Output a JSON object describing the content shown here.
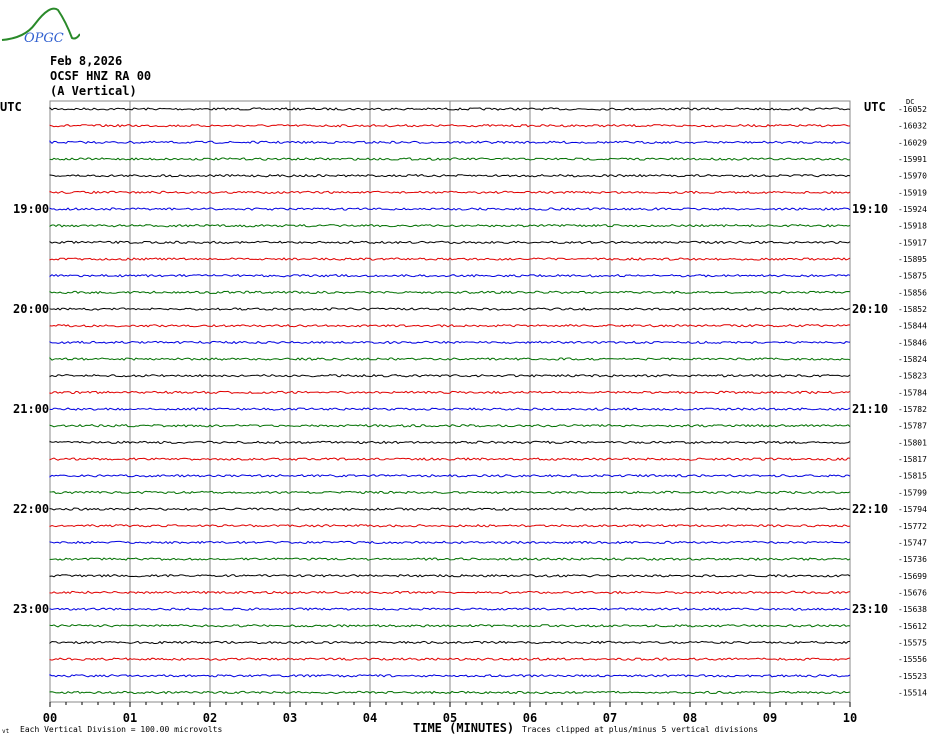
{
  "logo_text": "OPGC",
  "header": {
    "date": "Feb 8,2026",
    "station": "OCSF HNZ RA 00",
    "component": "(A Vertical)"
  },
  "left_utc": "UTC",
  "right_utc": "UTC",
  "dc_label": "DC",
  "left_times": [
    "19:00",
    "20:00",
    "21:00",
    "22:00",
    "23:00"
  ],
  "right_times": [
    "19:10",
    "20:10",
    "21:10",
    "22:10",
    "23:10"
  ],
  "footer": {
    "scale": "Each Vertical Division =  100.00 microvolts",
    "xlabel": "TIME (MINUTES)",
    "clip_note": "Traces clipped at plus/minus 5 vertical divisions",
    "corner": "vt"
  },
  "chart_data": {
    "type": "line",
    "title": "OCSF HNZ RA 00 helicorder",
    "xlabel": "TIME (MINUTES)",
    "xlim": [
      0,
      10
    ],
    "xticks": [
      "00",
      "01",
      "02",
      "03",
      "04",
      "05",
      "06",
      "07",
      "08",
      "09",
      "10"
    ],
    "trace_colors": [
      "#000000",
      "#e00000",
      "#0000e0",
      "#007000"
    ],
    "trace_count": 36,
    "dc_offsets": [
      -16052,
      -16032,
      -16029,
      -15991,
      -15970,
      -15919,
      -15924,
      -15918,
      -15917,
      -15895,
      -15875,
      -15856,
      -15852,
      -15844,
      -15846,
      -15824,
      -15823,
      -15784,
      -15782,
      -15787,
      -15801,
      -15817,
      -15815,
      -15799,
      -15794,
      -15772,
      -15747,
      -15736,
      -15699,
      -15676,
      -15638,
      -15612,
      -15575,
      -15556,
      -15523,
      -15514
    ]
  }
}
